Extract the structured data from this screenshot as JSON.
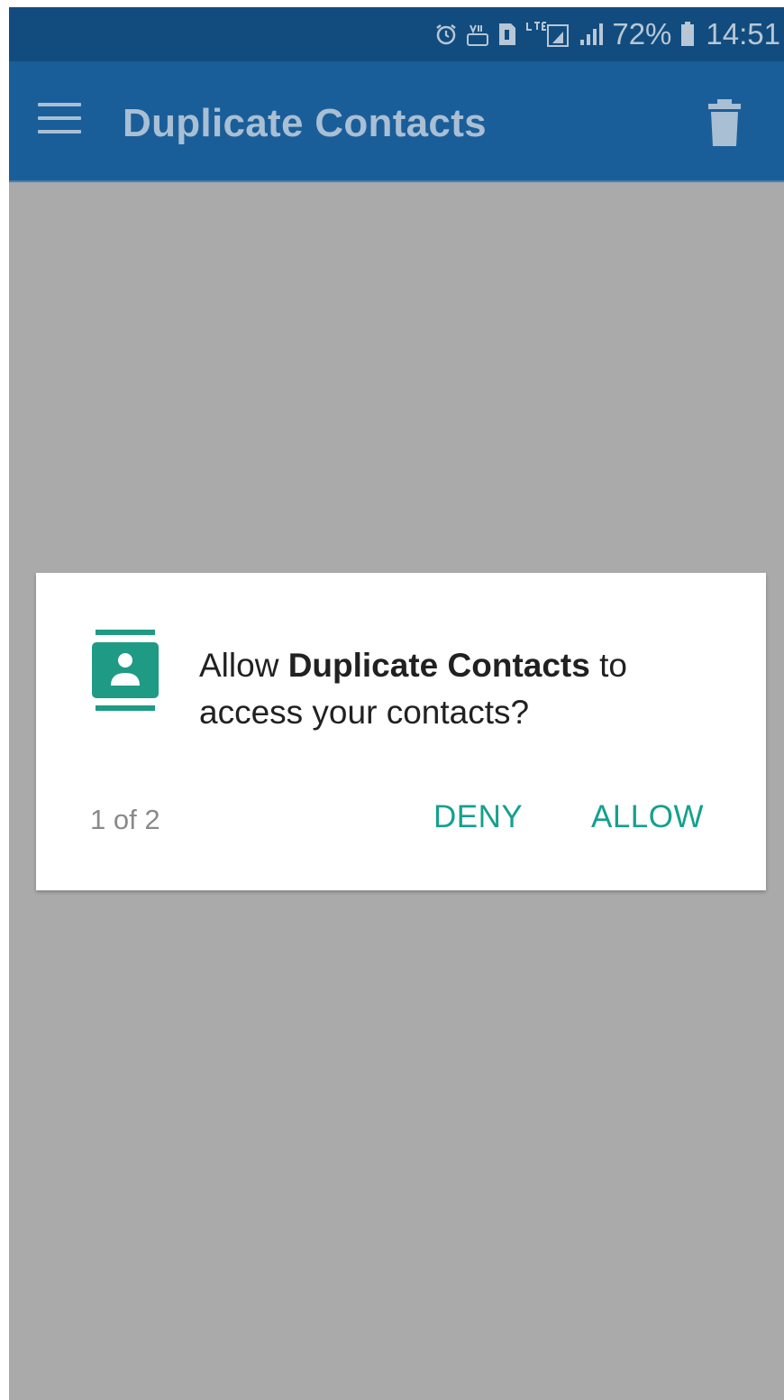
{
  "status_bar": {
    "battery_percent": "72%",
    "time": "14:51",
    "icons": [
      "alarm-icon",
      "volte-icon",
      "sim-icon",
      "lte-icon",
      "signal-icon",
      "battery-icon"
    ]
  },
  "app_bar": {
    "title": "Duplicate Contacts",
    "menu_icon": "menu-icon",
    "action_icon": "delete-icon"
  },
  "dialog": {
    "message_prefix": "Allow ",
    "app_name": "Duplicate Contacts",
    "message_suffix": " to access your contacts?",
    "counter": "1 of 2",
    "deny_label": "DENY",
    "allow_label": "ALLOW",
    "icon": "contacts-permission-icon"
  },
  "colors": {
    "status_bar": "#124c7e",
    "app_bar": "#1a5e99",
    "scrim": "#aaaaaa",
    "accent": "#16a08e",
    "icon_teal": "#1e9a85"
  }
}
